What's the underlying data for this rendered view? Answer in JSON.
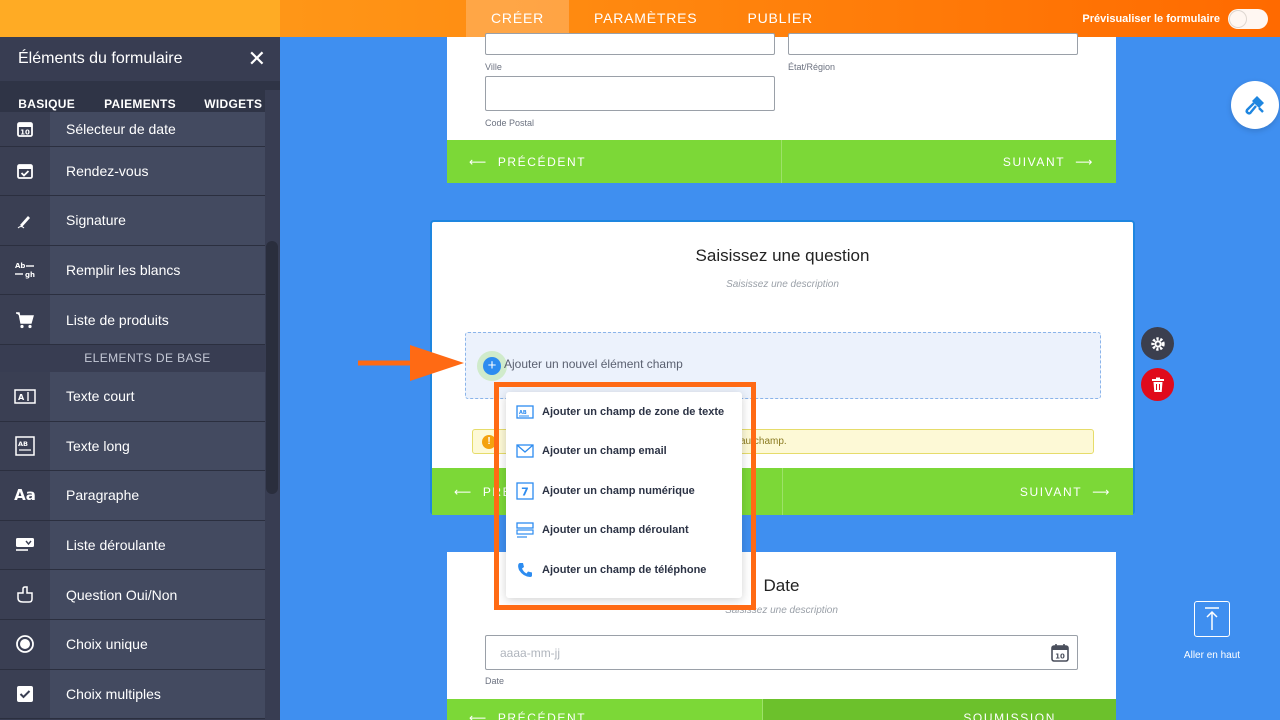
{
  "topbar": {
    "tabs": [
      {
        "label": "CRÉER",
        "active": true
      },
      {
        "label": "PARAMÈTRES",
        "active": false
      },
      {
        "label": "PUBLIER",
        "active": false
      }
    ],
    "preview_label": "Prévisualiser le formulaire",
    "preview_enabled": false
  },
  "sidebar": {
    "title": "Éléments du formulaire",
    "tabs": [
      {
        "label": "BASIQUE",
        "active": true
      },
      {
        "label": "PAIEMENTS",
        "active": false
      },
      {
        "label": "WIDGETS",
        "active": false
      }
    ],
    "items_top": [
      {
        "label": "Sélecteur de date",
        "icon": "calendar-date-icon"
      },
      {
        "label": "Rendez-vous",
        "icon": "calendar-check-icon"
      },
      {
        "label": "Signature",
        "icon": "pen-signature-icon"
      },
      {
        "label": "Remplir les blancs",
        "icon": "fill-blanks-icon"
      },
      {
        "label": "Liste de produits",
        "icon": "cart-icon"
      }
    ],
    "section_label": "ELEMENTS DE BASE",
    "items_base": [
      {
        "label": "Texte court",
        "icon": "short-text-icon"
      },
      {
        "label": "Texte long",
        "icon": "long-text-icon"
      },
      {
        "label": "Paragraphe",
        "icon": "paragraph-icon"
      },
      {
        "label": "Liste déroulante",
        "icon": "dropdown-list-icon"
      },
      {
        "label": "Question Oui/Non",
        "icon": "yes-no-icon"
      },
      {
        "label": "Choix unique",
        "icon": "radio-icon"
      },
      {
        "label": "Choix multiples",
        "icon": "checkbox-icon"
      }
    ]
  },
  "card_address": {
    "labels": {
      "city": "Ville",
      "state": "État/Région",
      "zip": "Code Postal"
    },
    "prev": "PRÉCÉDENT",
    "next": "SUIVANT"
  },
  "card_question": {
    "title": "Saisissez une question",
    "description": "Saisissez une description",
    "add_label": "Ajouter un nouvel élément champ",
    "warning_text": "au champ.",
    "prev": "PRÉ",
    "next": "SUIVANT"
  },
  "dropdown": {
    "items": [
      {
        "label": "Ajouter un champ de zone de texte",
        "icon": "text-area-icon"
      },
      {
        "label": "Ajouter un champ email",
        "icon": "email-icon"
      },
      {
        "label": "Ajouter un champ numérique",
        "icon": "number-icon"
      },
      {
        "label": "Ajouter un champ déroulant",
        "icon": "dropdown-icon"
      },
      {
        "label": "Ajouter un champ de téléphone",
        "icon": "phone-icon"
      }
    ]
  },
  "card_date": {
    "title": "Date",
    "description": "Saisissez une description",
    "placeholder": "aaaa-mm-jj",
    "sublabel": "Date",
    "prev": "PRÉCÉDENT",
    "next": "SOUMISSION"
  },
  "right": {
    "go_top_label": "Aller en haut"
  },
  "colors": {
    "accent": "#ff7a1a",
    "canvas": "#3f8ff0",
    "nav_green": "#7cd837",
    "delete_red": "#e00a1b",
    "highlight": "#ff6a14"
  }
}
